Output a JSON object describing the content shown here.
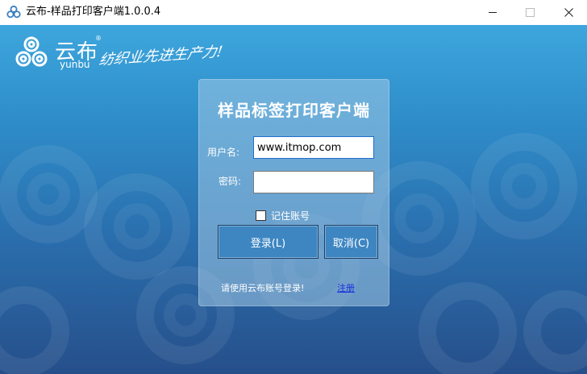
{
  "window": {
    "title": "云布-样品打印客户端1.0.0.4",
    "minimize_icon": "minimize-icon",
    "maximize_icon": "maximize-icon",
    "close_icon": "close-icon"
  },
  "brand": {
    "name_cn": "云布",
    "registered": "®",
    "name_en": "yunbu",
    "slogan": "纺织业先进生产力!",
    "logo_icon": "yunbu-swirl-logo-icon"
  },
  "login": {
    "title": "样品标签打印客户端",
    "username_label": "用户名:",
    "username_value": "www.itmop.com",
    "password_label": "密码:",
    "password_value": "",
    "remember_label": "记住账号",
    "remember_checked": false,
    "login_button": "登录(L)",
    "cancel_button": "取消(C)",
    "hint": "请使用云布账号登录!",
    "register_link": "注册"
  },
  "colors": {
    "background_top": "#3ea6dd",
    "background_bottom": "#264f8a",
    "button": "#3d86c2",
    "link": "#1a2ee0"
  }
}
